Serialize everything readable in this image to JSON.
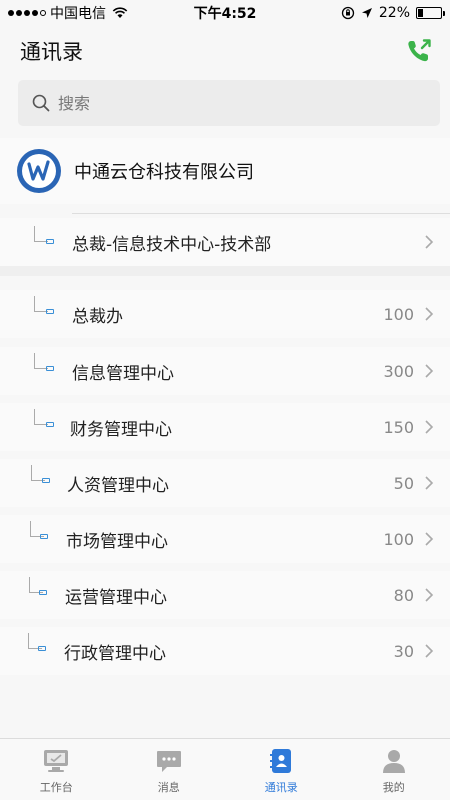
{
  "status_bar": {
    "carrier": "中国电信",
    "time": "下午4:52",
    "battery": "22%",
    "battery_level": 0.22
  },
  "header": {
    "title": "通讯录"
  },
  "search": {
    "placeholder": "搜索"
  },
  "company": {
    "name": "中通云仓科技有限公司"
  },
  "departments": [
    {
      "name": "总裁-信息技术中心-技术部",
      "count": ""
    },
    {
      "name": "总裁办",
      "count": "100"
    },
    {
      "name": "信息管理中心",
      "count": "300"
    },
    {
      "name": "财务管理中心",
      "count": "150"
    },
    {
      "name": "人资管理中心",
      "count": "50"
    },
    {
      "name": "市场管理中心",
      "count": "100"
    },
    {
      "name": "运营管理中心",
      "count": "80"
    },
    {
      "name": "行政管理中心",
      "count": "30"
    }
  ],
  "tabs": [
    {
      "label": "工作台",
      "icon": "desktop-icon"
    },
    {
      "label": "消息",
      "icon": "chat-bubble-icon"
    },
    {
      "label": "通讯录",
      "icon": "contacts-icon",
      "active": true
    },
    {
      "label": "我的",
      "icon": "person-icon"
    }
  ],
  "colors": {
    "accent": "#2f7ad9",
    "phone_green": "#3bb34a",
    "node_blue": "#3a8fd6"
  }
}
